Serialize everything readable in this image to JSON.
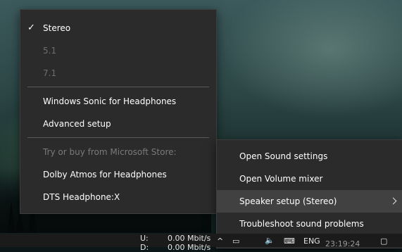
{
  "speaker_menu": {
    "items": [
      {
        "label": "Stereo",
        "checked": true,
        "enabled": true
      },
      {
        "label": "5.1",
        "enabled": false
      },
      {
        "label": "7.1",
        "enabled": false
      },
      {
        "label": "Windows Sonic for Headphones",
        "enabled": true
      },
      {
        "label": "Advanced setup",
        "enabled": true
      },
      {
        "label": "Try or buy from Microsoft Store:",
        "enabled": false
      },
      {
        "label": "Dolby Atmos for Headphones",
        "enabled": true
      },
      {
        "label": "DTS Headphone:X",
        "enabled": true
      }
    ],
    "checkmark": "✓"
  },
  "sound_menu": {
    "items": [
      {
        "label": "Open Sound settings"
      },
      {
        "label": "Open Volume mixer"
      },
      {
        "label": "Speaker setup (Stereo)",
        "has_submenu": true,
        "highlighted": true
      },
      {
        "label": "Troubleshoot sound problems"
      }
    ]
  },
  "taskbar": {
    "net_upload_label": "U:",
    "net_upload_value": "0.00 Mbit/s",
    "net_download_label": "D:",
    "net_download_value": "0.00 Mbit/s",
    "language": "ENG",
    "time": "23:19:24"
  },
  "colors": {
    "menu_bg": "#2b2b2b",
    "highlight_bg": "#414141",
    "text": "#ffffff",
    "disabled_text": "#6e6e6e"
  }
}
